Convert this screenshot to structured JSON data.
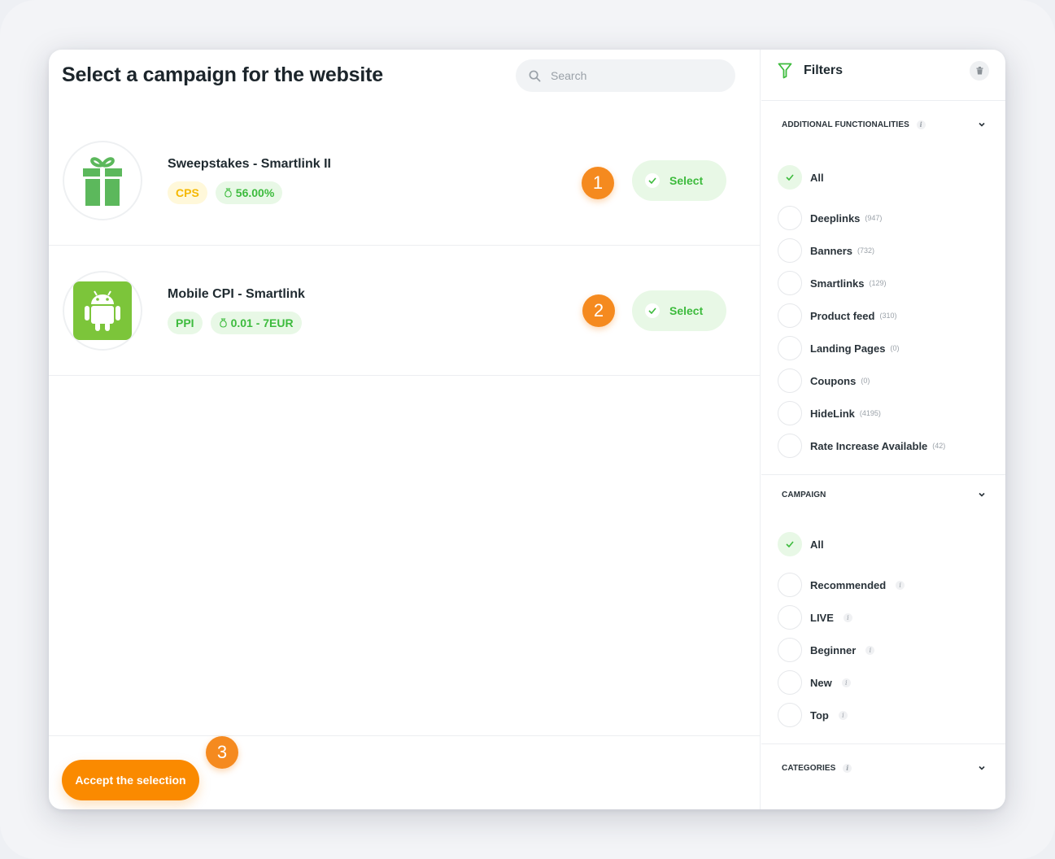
{
  "page": {
    "title": "Select a campaign for the website",
    "search_placeholder": "Search"
  },
  "campaigns": [
    {
      "name": "Sweepstakes - Smartlink II",
      "type_badge": "CPS",
      "rate": "56.00%",
      "icon": "gift-icon",
      "step": "1",
      "select_label": "Select"
    },
    {
      "name": "Mobile CPI - Smartlink",
      "type_badge": "PPI",
      "rate": "0.01 - 7EUR",
      "icon": "android-icon",
      "step": "2",
      "select_label": "Select"
    }
  ],
  "footer": {
    "accept_label": "Accept the selection",
    "step": "3"
  },
  "filters": {
    "title": "Filters",
    "info_glyph": "i",
    "sections": {
      "additional": {
        "title": "ADDITIONAL FUNCTIONALITIES",
        "options": [
          {
            "label": "All",
            "count": "",
            "checked": true
          },
          {
            "label": "Deeplinks",
            "count": "(947)",
            "checked": false
          },
          {
            "label": "Banners",
            "count": "(732)",
            "checked": false
          },
          {
            "label": "Smartlinks",
            "count": "(129)",
            "checked": false
          },
          {
            "label": "Product feed",
            "count": "(310)",
            "checked": false
          },
          {
            "label": "Landing Pages",
            "count": "(0)",
            "checked": false
          },
          {
            "label": "Coupons",
            "count": "(0)",
            "checked": false
          },
          {
            "label": "HideLink",
            "count": "(4195)",
            "checked": false
          },
          {
            "label": "Rate Increase Available",
            "count": "(42)",
            "checked": false
          }
        ]
      },
      "campaign": {
        "title": "CAMPAIGN",
        "options": [
          {
            "label": "All",
            "checked": true
          },
          {
            "label": "Recommended",
            "checked": false
          },
          {
            "label": "LIVE",
            "checked": false
          },
          {
            "label": "Beginner",
            "checked": false
          },
          {
            "label": "New",
            "checked": false
          },
          {
            "label": "Top",
            "checked": false
          }
        ]
      },
      "categories": {
        "title": "CATEGORIES"
      }
    }
  },
  "colors": {
    "accent_green": "#3dbb3d",
    "accent_orange": "#f58a1f",
    "cps_yellow": "#f5b800"
  }
}
